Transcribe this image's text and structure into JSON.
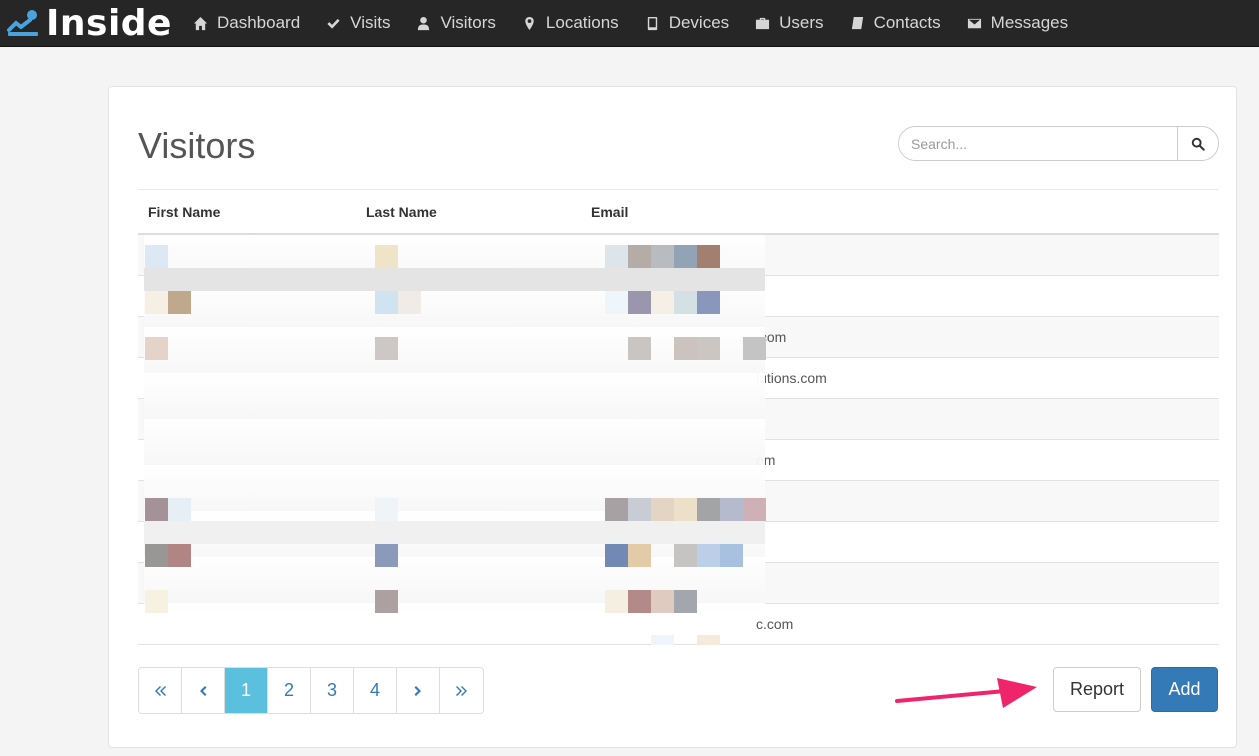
{
  "navbar": {
    "brand": "Inside",
    "items": [
      {
        "label": "Dashboard",
        "icon": "home-icon"
      },
      {
        "label": "Visits",
        "icon": "check-icon"
      },
      {
        "label": "Visitors",
        "icon": "user-icon"
      },
      {
        "label": "Locations",
        "icon": "map-marker-icon"
      },
      {
        "label": "Devices",
        "icon": "tablet-icon"
      },
      {
        "label": "Users",
        "icon": "briefcase-icon"
      },
      {
        "label": "Contacts",
        "icon": "book-icon"
      },
      {
        "label": "Messages",
        "icon": "envelope-icon"
      }
    ]
  },
  "page": {
    "title": "Visitors",
    "search_placeholder": "Search..."
  },
  "table": {
    "headers": [
      "First Name",
      "Last Name",
      "Email"
    ],
    "rows": [
      {
        "email_tail": ""
      },
      {
        "email_tail": ""
      },
      {
        "email_tail": ".com"
      },
      {
        "email_tail": "lutions.com"
      },
      {
        "email_tail": ""
      },
      {
        "email_tail": "om"
      },
      {
        "email_tail": ""
      },
      {
        "email_tail": ""
      },
      {
        "email_tail": ""
      },
      {
        "email_tail": "c.com"
      }
    ]
  },
  "pagination": {
    "first": "first-page-icon",
    "prev": "prev-page-icon",
    "pages": [
      "1",
      "2",
      "3",
      "4"
    ],
    "active": "1",
    "next": "next-page-icon",
    "last": "last-page-icon"
  },
  "actions": {
    "report_label": "Report",
    "add_label": "Add"
  },
  "colors": {
    "navbar_bg": "#262626",
    "primary": "#337ab7",
    "active_page": "#5bc0de",
    "annotation_arrow": "#f0246a"
  }
}
